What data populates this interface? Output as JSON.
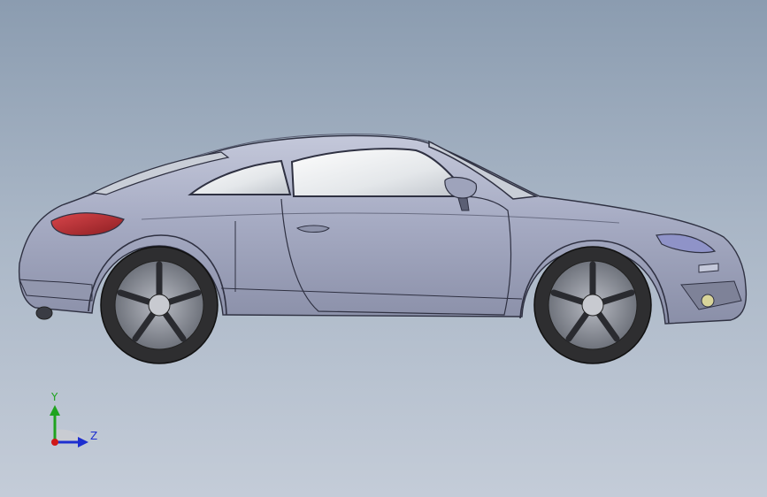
{
  "view": {
    "background_top": "#8b9cb0",
    "background_bottom": "#c4ccd8"
  },
  "model": {
    "body_color": "#a2a7bf",
    "glass_color": "#eef0f2",
    "taillight_color": "#b3262b",
    "tire_color": "#2e2e30",
    "rim_color": "#8d9098"
  },
  "triad": {
    "y_label": "Y",
    "z_label": "Z",
    "y_color": "#1fa31f",
    "z_color": "#1d2fd0",
    "x_color": "#d01818"
  }
}
